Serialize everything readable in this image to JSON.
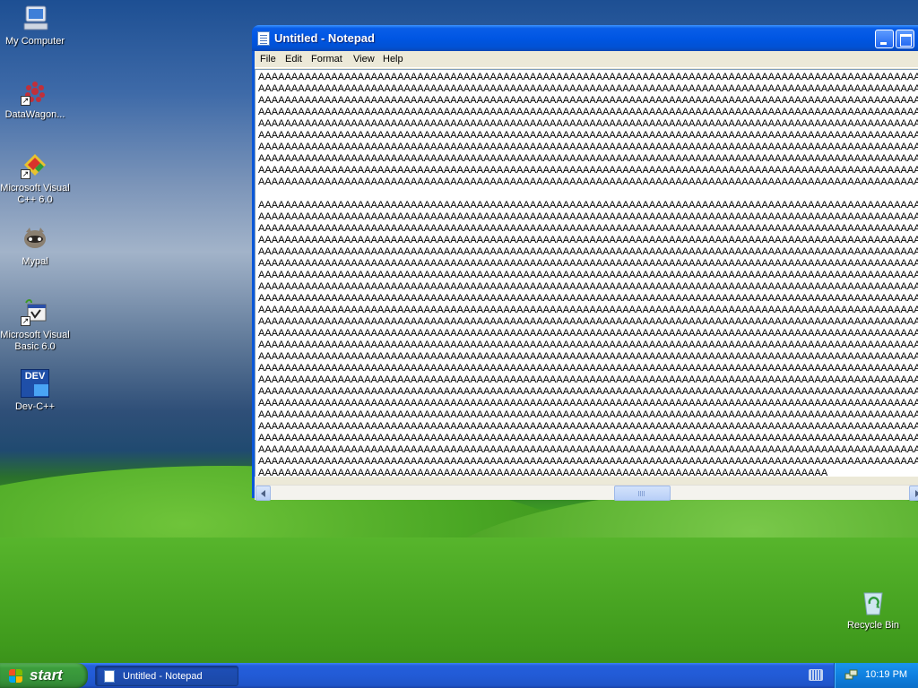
{
  "desktop": {
    "icons": [
      {
        "id": "my-computer",
        "label": "My Computer"
      },
      {
        "id": "datawagon",
        "label": "DataWagon..."
      },
      {
        "id": "msvc",
        "label": "Microsoft Visual C++ 6.0"
      },
      {
        "id": "mypal",
        "label": "Mypal"
      },
      {
        "id": "msvb",
        "label": "Microsoft Visual Basic 6.0"
      },
      {
        "id": "devcpp",
        "label": "Dev-C++"
      },
      {
        "id": "recycle-bin",
        "label": "Recycle Bin"
      }
    ],
    "devcpp_badge": "DEV"
  },
  "notepad": {
    "title": "Untitled - Notepad",
    "menu": [
      "File",
      "Edit",
      "Format",
      "View",
      "Help"
    ],
    "content": {
      "full_line": "AAAAAAAAAAAAAAAAAAAAAAAAAAAAAAAAAAAAAAAAAAAAAAAAAAAAAAAAAAAAAAAAAAAAAAAAAAAAAAAAAAAAAAAAAAAAAAAAAAAAAAAAAAAAAAAAAAAAAAAAAAAA",
      "last_line": "AAAAAAAAAAAAAAAAAAAAAAAAAAAAAAAAAAAAAAAAAAAAAAAAAAAAAAAAAAAAAAAAAAAAAAAAAAAAAAAAAAAAAA",
      "first_block_lines": 10,
      "second_block_lines": 23
    }
  },
  "taskbar": {
    "start_label": "start",
    "tasks": [
      {
        "label": "Untitled - Notepad"
      }
    ],
    "clock": "10:19 PM"
  },
  "colors": {
    "titlebar": "#0056e3",
    "taskbar": "#245edb",
    "start_button": "#36923a",
    "tray": "#0f80e0"
  }
}
